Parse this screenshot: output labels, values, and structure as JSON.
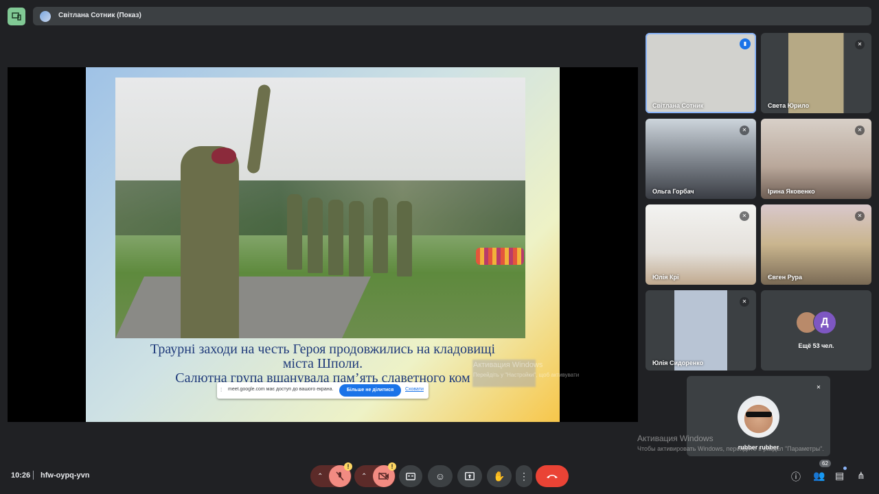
{
  "window": {
    "presenter_title": "Світлана Сотник (Показ)"
  },
  "slide": {
    "caption_lines": [
      "Траурні заходи на честь Героя продовжились на кладовищі",
      "міста Шполи.",
      "Салютна група вшанувала пам’ять славетного ком"
    ]
  },
  "share_bar": {
    "message": "meet.google.com має доступ до вашого екрана.",
    "stop_label": "Більше не ділитися",
    "hide_label": "Сховати"
  },
  "participants": [
    {
      "name": "Світлана Сотник",
      "state": "speaking",
      "color": "#cfd3d6"
    },
    {
      "name": "Света Юрило",
      "state": "muted",
      "color": "#9b8a6d"
    },
    {
      "name": "Ольга Горбач",
      "state": "muted",
      "color": "#8d8f94"
    },
    {
      "name": "Ірина Яковенко",
      "state": "muted",
      "color": "#b9a79a"
    },
    {
      "name": "Юлія Крі",
      "state": "muted",
      "color": "#d9d6d2"
    },
    {
      "name": "Євген Рура",
      "state": "muted",
      "color": "#b8a66e"
    },
    {
      "name": "Юлія Сидоренко",
      "state": "muted",
      "color": "#6e7a8e"
    }
  ],
  "more": {
    "avatar_letter": "Д",
    "label": "Ещё 53 чел."
  },
  "self_tile": {
    "name": "rubber rubber"
  },
  "watermark": {
    "line1": "Активация Windows",
    "line2": "Чтобы активировать Windows, перейдите в раздел \"Параметры\".",
    "slide_line1": "Активация Windows",
    "slide_line2": "Перейдіть у \"Настройки\", щоб активувати"
  },
  "bottom_bar": {
    "time": "10:26",
    "meeting_code": "hfw-oypq-yvn",
    "warning_glyph": "!",
    "people_count": "62"
  },
  "icons": {
    "mic_off": "mic-off-icon",
    "cam_off": "videocam-off-icon",
    "captions": "closed-caption-icon",
    "emoji": "emoji-icon",
    "present": "present-screen-icon",
    "hand": "raise-hand-icon",
    "more": "more-vert-icon",
    "hangup": "call-end-icon",
    "info": "info-icon",
    "people": "people-icon",
    "chat": "chat-icon",
    "activities": "activities-icon"
  }
}
